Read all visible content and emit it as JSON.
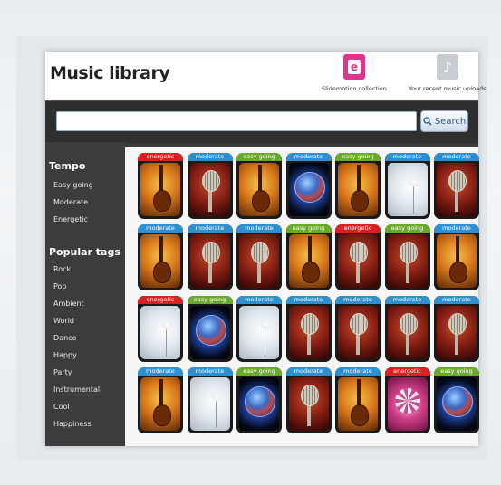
{
  "header": {
    "title": "Music library",
    "actions": [
      {
        "label": "Slidemotion collection",
        "icon": "slidemotion-logo-icon"
      },
      {
        "label": "Your recent music uploads",
        "icon": "music-upload-icon"
      }
    ]
  },
  "search": {
    "value": "",
    "button_label": "Search",
    "icon": "magnifier-icon"
  },
  "sidebar": {
    "tempo_heading": "Tempo",
    "tempo_items": [
      "Easy going",
      "Moderate",
      "Energetic"
    ],
    "tags_heading": "Popular tags",
    "tag_items": [
      "Rock",
      "Pop",
      "Ambient",
      "World",
      "Dance",
      "Happy",
      "Party",
      "Instrumental",
      "Cool",
      "Happiness"
    ]
  },
  "grid": {
    "tiles": [
      {
        "tag": "energetic",
        "art": "guitar"
      },
      {
        "tag": "moderate",
        "art": "microphone"
      },
      {
        "tag": "easy going",
        "art": "guitar"
      },
      {
        "tag": "moderate",
        "art": "globe"
      },
      {
        "tag": "easy going",
        "art": "guitar"
      },
      {
        "tag": "moderate",
        "art": "dandelion"
      },
      {
        "tag": "moderate",
        "art": "microphone"
      },
      {
        "tag": "moderate",
        "art": "guitar"
      },
      {
        "tag": "moderate",
        "art": "microphone"
      },
      {
        "tag": "moderate",
        "art": "microphone"
      },
      {
        "tag": "easy going",
        "art": "guitar"
      },
      {
        "tag": "energetic",
        "art": "microphone"
      },
      {
        "tag": "easy going",
        "art": "microphone"
      },
      {
        "tag": "moderate",
        "art": "guitar"
      },
      {
        "tag": "energetic",
        "art": "dandelion"
      },
      {
        "tag": "easy going",
        "art": "globe"
      },
      {
        "tag": "moderate",
        "art": "dandelion"
      },
      {
        "tag": "moderate",
        "art": "microphone"
      },
      {
        "tag": "moderate",
        "art": "microphone"
      },
      {
        "tag": "moderate",
        "art": "microphone"
      },
      {
        "tag": "moderate",
        "art": "microphone"
      },
      {
        "tag": "moderate",
        "art": "guitar"
      },
      {
        "tag": "moderate",
        "art": "dandelion"
      },
      {
        "tag": "easy going",
        "art": "globe"
      },
      {
        "tag": "moderate",
        "art": "microphone"
      },
      {
        "tag": "moderate",
        "art": "guitar"
      },
      {
        "tag": "energetic",
        "art": "disco-ball"
      },
      {
        "tag": "easy going",
        "art": "globe"
      }
    ],
    "tag_colors": {
      "energetic": "#d82222",
      "moderate": "#2f8fd0",
      "easy going": "#6aaa2a"
    }
  }
}
